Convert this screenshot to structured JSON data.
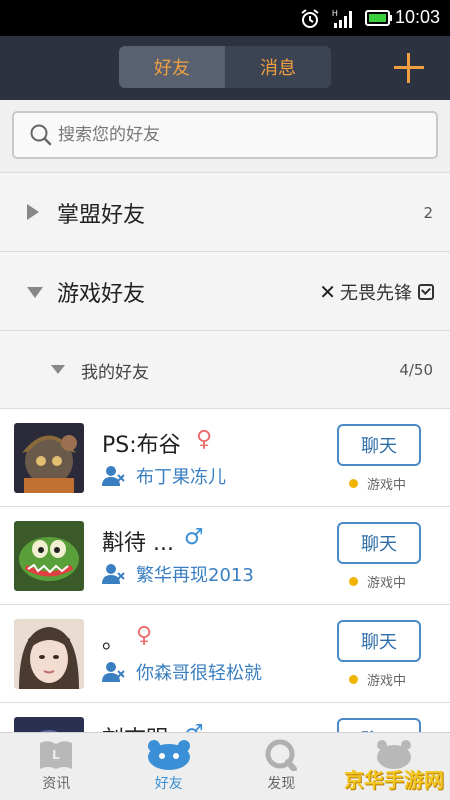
{
  "status_bar": {
    "time": "10:03"
  },
  "header": {
    "tabs": [
      {
        "label": "好友",
        "active": true
      },
      {
        "label": "消息",
        "active": false
      }
    ],
    "add_icon": "plus-icon",
    "accent_color": "#f0a040"
  },
  "search": {
    "placeholder": "搜索您的好友"
  },
  "groups": {
    "league": {
      "label": "掌盟好友",
      "count": "2",
      "expanded": false
    },
    "game": {
      "label": "游戏好友",
      "expanded": true,
      "game_filter": "无畏先锋"
    },
    "mine": {
      "label": "我的好友",
      "count": "4/50",
      "expanded": true
    }
  },
  "friends": [
    {
      "name": "PS:布谷",
      "gender": "female",
      "gender_symbol": "♀",
      "game_name": "布丁果冻儿",
      "chat_label": "聊天",
      "status": "游戏中"
    },
    {
      "name": "斠待 ...",
      "gender": "male",
      "gender_symbol": "♂",
      "game_name": "繁华再现2013",
      "chat_label": "聊天",
      "status": "游戏中"
    },
    {
      "name": "。",
      "gender": "female",
      "gender_symbol": "♀",
      "game_name": "你森哥很轻松就",
      "chat_label": "聊天",
      "status": "游戏中"
    },
    {
      "name": "刘志明",
      "gender": "male",
      "gender_symbol": "♂",
      "game_name": "",
      "chat_label": "聊天",
      "status": ""
    }
  ],
  "bottom_nav": [
    {
      "label": "资讯",
      "icon": "news-icon",
      "active": false
    },
    {
      "label": "好友",
      "icon": "friends-icon",
      "active": true
    },
    {
      "label": "发现",
      "icon": "discover-icon",
      "active": false
    },
    {
      "label": "",
      "icon": "more-icon",
      "active": false
    }
  ],
  "watermark": "京华手游网"
}
